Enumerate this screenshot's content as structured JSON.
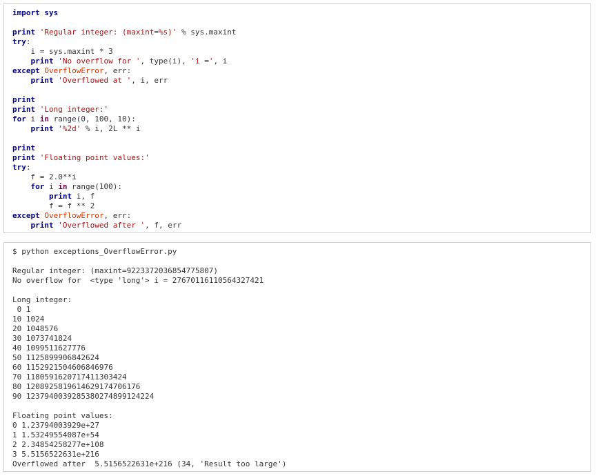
{
  "colors": {
    "keyword": "#000080",
    "in_keyword": "#7f0055",
    "string": "#a31515",
    "exception": "#cc3300",
    "text": "#333333",
    "border": "#cfcfcf"
  },
  "code": [
    [
      {
        "t": "kw",
        "s": "import"
      },
      {
        "t": "nm",
        "s": " "
      },
      {
        "t": "kw",
        "s": "sys"
      }
    ],
    [],
    [
      {
        "t": "kw",
        "s": "print"
      },
      {
        "t": "nm",
        "s": " "
      },
      {
        "t": "str",
        "s": "'Regular integer: (maxint=%s)'"
      },
      {
        "t": "nm",
        "s": " % sys.maxint"
      }
    ],
    [
      {
        "t": "kw",
        "s": "try"
      },
      {
        "t": "nm",
        "s": ":"
      }
    ],
    [
      {
        "t": "nm",
        "s": "    i = sys.maxint * 3"
      }
    ],
    [
      {
        "t": "nm",
        "s": "    "
      },
      {
        "t": "kw",
        "s": "print"
      },
      {
        "t": "nm",
        "s": " "
      },
      {
        "t": "str",
        "s": "'No overflow for '"
      },
      {
        "t": "nm",
        "s": ", type(i), "
      },
      {
        "t": "str",
        "s": "'i ='"
      },
      {
        "t": "nm",
        "s": ", i"
      }
    ],
    [
      {
        "t": "kw",
        "s": "except"
      },
      {
        "t": "nm",
        "s": " "
      },
      {
        "t": "exc",
        "s": "OverflowError"
      },
      {
        "t": "nm",
        "s": ", err:"
      }
    ],
    [
      {
        "t": "nm",
        "s": "    "
      },
      {
        "t": "kw",
        "s": "print"
      },
      {
        "t": "nm",
        "s": " "
      },
      {
        "t": "str",
        "s": "'Overflowed at '"
      },
      {
        "t": "nm",
        "s": ", i, err"
      }
    ],
    [],
    [
      {
        "t": "kw",
        "s": "print"
      }
    ],
    [
      {
        "t": "kw",
        "s": "print"
      },
      {
        "t": "nm",
        "s": " "
      },
      {
        "t": "str",
        "s": "'Long integer:'"
      }
    ],
    [
      {
        "t": "kw",
        "s": "for"
      },
      {
        "t": "nm",
        "s": " i "
      },
      {
        "t": "kw2",
        "s": "in"
      },
      {
        "t": "nm",
        "s": " range(0, 100, 10):"
      }
    ],
    [
      {
        "t": "nm",
        "s": "    "
      },
      {
        "t": "kw",
        "s": "print"
      },
      {
        "t": "nm",
        "s": " "
      },
      {
        "t": "str",
        "s": "'%2d'"
      },
      {
        "t": "nm",
        "s": " % i, 2L ** i"
      }
    ],
    [],
    [
      {
        "t": "kw",
        "s": "print"
      }
    ],
    [
      {
        "t": "kw",
        "s": "print"
      },
      {
        "t": "nm",
        "s": " "
      },
      {
        "t": "str",
        "s": "'Floating point values:'"
      }
    ],
    [
      {
        "t": "kw",
        "s": "try"
      },
      {
        "t": "nm",
        "s": ":"
      }
    ],
    [
      {
        "t": "nm",
        "s": "    f = 2.0**i"
      }
    ],
    [
      {
        "t": "nm",
        "s": "    "
      },
      {
        "t": "kw",
        "s": "for"
      },
      {
        "t": "nm",
        "s": " i "
      },
      {
        "t": "kw2",
        "s": "in"
      },
      {
        "t": "nm",
        "s": " range(100):"
      }
    ],
    [
      {
        "t": "nm",
        "s": "        "
      },
      {
        "t": "kw",
        "s": "print"
      },
      {
        "t": "nm",
        "s": " i, f"
      }
    ],
    [
      {
        "t": "nm",
        "s": "        f = f ** 2"
      }
    ],
    [
      {
        "t": "kw",
        "s": "except"
      },
      {
        "t": "nm",
        "s": " "
      },
      {
        "t": "exc",
        "s": "OverflowError"
      },
      {
        "t": "nm",
        "s": ", err:"
      }
    ],
    [
      {
        "t": "nm",
        "s": "    "
      },
      {
        "t": "kw",
        "s": "print"
      },
      {
        "t": "nm",
        "s": " "
      },
      {
        "t": "str",
        "s": "'Overflowed after '"
      },
      {
        "t": "nm",
        "s": ", f, err"
      }
    ]
  ],
  "output": [
    "$ python exceptions_OverflowError.py",
    "",
    "Regular integer: (maxint=9223372036854775807)",
    "No overflow for  <type 'long'> i = 27670116110564327421",
    "",
    "Long integer:",
    " 0 1",
    "10 1024",
    "20 1048576",
    "30 1073741824",
    "40 1099511627776",
    "50 1125899906842624",
    "60 1152921504606846976",
    "70 1180591620717411303424",
    "80 1208925819614629174706176",
    "90 1237940039285380274899124224",
    "",
    "Floating point values:",
    "0 1.23794003929e+27",
    "1 1.53249554087e+54",
    "2 2.34854258277e+108",
    "3 5.5156522631e+216",
    "Overflowed after  5.5156522631e+216 (34, 'Result too large')"
  ]
}
